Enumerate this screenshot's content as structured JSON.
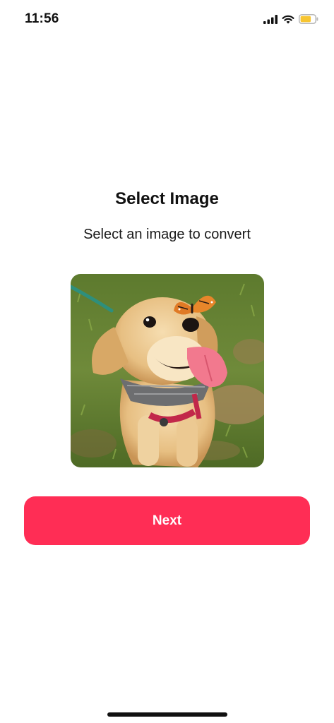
{
  "status_bar": {
    "time": "11:56",
    "icons": [
      "signal-icon",
      "wifi-icon",
      "battery-icon"
    ],
    "battery_color": "#f7c531"
  },
  "header": {
    "title": "Select Image",
    "subtitle": "Select an image to convert"
  },
  "selected_image": {
    "subject": "golden retriever puppy with butterfly on nose"
  },
  "actions": {
    "next_label": "Next",
    "accent_color": "#ff2d55"
  }
}
